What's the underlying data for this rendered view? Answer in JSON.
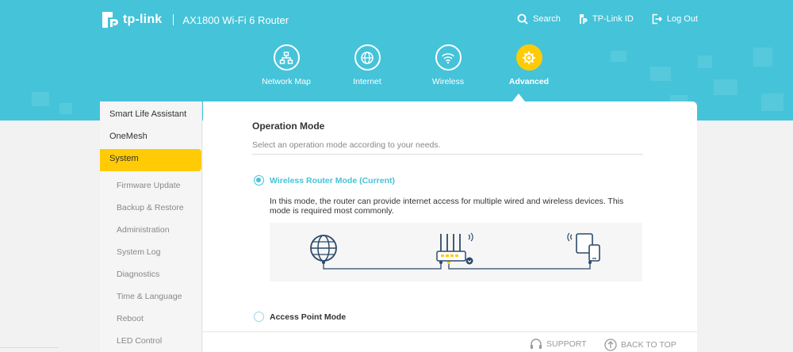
{
  "brand": {
    "logo_text": "tp-link",
    "model": "AX1800 Wi-Fi 6 Router"
  },
  "top_nav": {
    "search": "Search",
    "tplink_id": "TP-Link ID",
    "logout": "Log Out"
  },
  "modes": [
    {
      "label": "Network Map",
      "icon": "network-map-icon"
    },
    {
      "label": "Internet",
      "icon": "globe-icon"
    },
    {
      "label": "Wireless",
      "icon": "wifi-icon"
    },
    {
      "label": "Advanced",
      "icon": "gear-icon",
      "active": true
    }
  ],
  "sidebar": {
    "items": [
      "Smart Life Assistant",
      "OneMesh",
      "System"
    ],
    "active": "System",
    "subitems": [
      "Firmware Update",
      "Backup & Restore",
      "Administration",
      "System Log",
      "Diagnostics",
      "Time & Language",
      "Reboot",
      "LED Control"
    ]
  },
  "main": {
    "title": "Operation Mode",
    "subtitle": "Select an operation mode according to your needs.",
    "options": [
      {
        "label": "Wireless Router Mode (Current)",
        "checked": true
      },
      {
        "label": "Access Point Mode",
        "checked": false
      }
    ],
    "router_mode_desc": "In this mode, the router can provide internet access for multiple wired and wireless devices. This mode is required most commonly."
  },
  "footer": {
    "support": "SUPPORT",
    "back_to_top": "BACK TO TOP"
  },
  "colors": {
    "header": "#45c3d9",
    "accent": "#ffcb06",
    "radio": "#45c3d9"
  }
}
